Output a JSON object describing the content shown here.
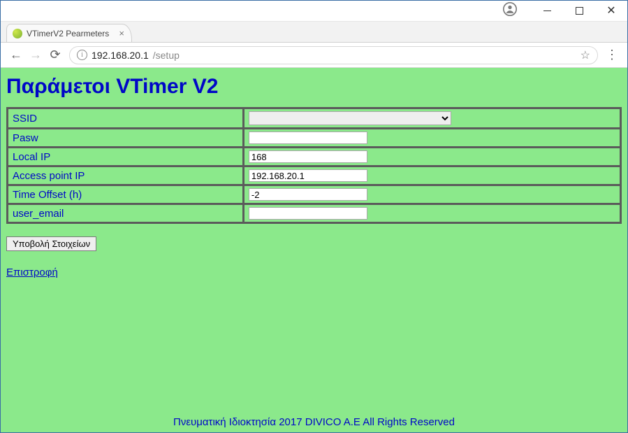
{
  "window": {
    "tab_title": "VTimerV2 Pearmeters",
    "url_host": "192.168.20.1",
    "url_path": "/setup"
  },
  "page": {
    "title": "Παράμετοι VTimer V2",
    "rows": {
      "ssid": {
        "label": "SSID",
        "value": ""
      },
      "pasw": {
        "label": "Pasw",
        "value": ""
      },
      "local_ip": {
        "label": "Local IP",
        "value": "168"
      },
      "ap_ip": {
        "label": "Access point IP",
        "value": "192.168.20.1"
      },
      "time_offset": {
        "label": "Time Offset (h)",
        "value": "-2"
      },
      "user_email": {
        "label": "user_email",
        "value": ""
      }
    },
    "submit_label": "Υποβολή Στοιχείων",
    "back_label": "Επιστροφή",
    "footer": "Πνευματική Ιδιοκτησία 2017 DIVICO A.E All Rights Reserved"
  }
}
